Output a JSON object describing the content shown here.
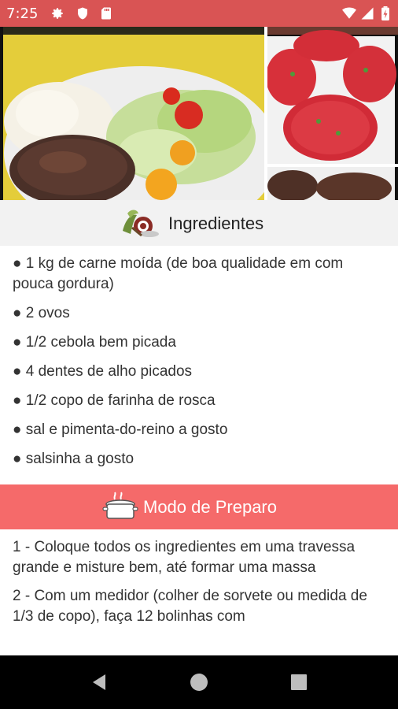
{
  "status_bar": {
    "time": "7:25",
    "icons": [
      "gear-icon",
      "shield-icon",
      "sd-card-icon"
    ],
    "right_icons": [
      "wifi-icon",
      "signal-icon",
      "battery-icon"
    ],
    "color": "#d95454"
  },
  "hero": {
    "images": [
      "meatball-plate-photo",
      "raw-burger-patties-photo",
      "cooked-patties-photo"
    ]
  },
  "ingredients": {
    "title": "Ingredientes",
    "icon": "vegetables-icon",
    "items": [
      "● 1 kg de carne moída (de boa qualidade em com pouca gordura)",
      "● 2 ovos",
      "● 1/2 cebola bem picada",
      "● 4 dentes de alho picados",
      "● 1/2 copo de farinha de rosca",
      "● sal e pimenta-do-reino a gosto",
      "● salsinha a gosto"
    ]
  },
  "preparation": {
    "title": "Modo de Preparo",
    "icon": "cooking-pot-icon",
    "color": "#f56a6a",
    "steps": [
      "1 - Coloque todos os ingredientes em uma travessa grande e misture bem, até formar uma massa",
      "2 - Com um medidor (colher de sorvete ou medida de 1/3 de copo), faça 12 bolinhas com"
    ]
  },
  "nav_bar": {
    "buttons": [
      "back-icon",
      "home-icon",
      "recents-icon"
    ]
  }
}
